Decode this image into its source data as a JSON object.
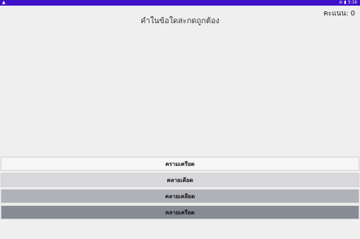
{
  "status_bar": {
    "left_icon": "warning-icon",
    "right_icons": [
      "no-sim-icon",
      "battery-icon"
    ],
    "time": "3:16"
  },
  "header": {
    "score_label": "คะแนน: 0",
    "question": "คำในข้อใดสะกดถูกต้อง"
  },
  "answers": [
    {
      "label": "ครามเครียด"
    },
    {
      "label": "คลายเคียด"
    },
    {
      "label": "คลายเคลียด"
    },
    {
      "label": "คลายเครียด"
    }
  ],
  "colors": {
    "status_bar": "#3f11c9",
    "background": "#efefef",
    "answer_1": "#f6f6f6",
    "answer_2": "#d9d9dd",
    "answer_3": "#b1b2b8",
    "answer_4": "#868b96"
  }
}
